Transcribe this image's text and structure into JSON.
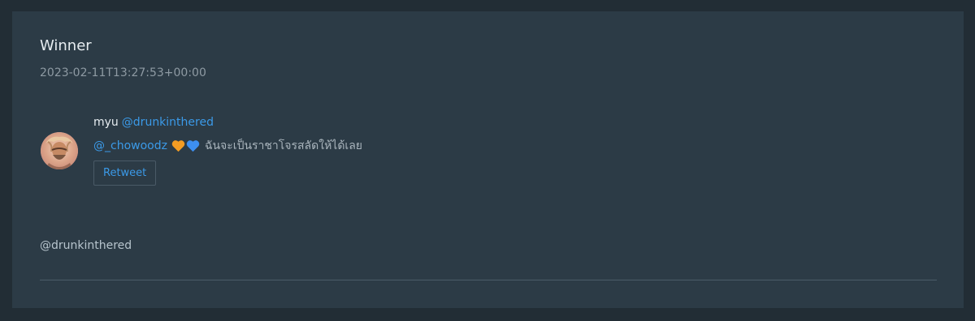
{
  "card": {
    "title": "Winner",
    "timestamp": "2023-02-11T13:27:53+00:00"
  },
  "tweet": {
    "author_name": "myu",
    "author_handle": "@drunkinthered",
    "mention": "@_chowoodz",
    "emojis": [
      "orange-heart-icon",
      "blue-heart-icon"
    ],
    "text": "ฉันจะเป็นราชาโจรสลัดให้ได้เลย",
    "retweet_label": "Retweet",
    "avatar_icon": "user-avatar"
  },
  "footer": {
    "handle": "@drunkinthered"
  },
  "colors": {
    "background": "#222d35",
    "card": "#2c3b46",
    "link": "#3b9ae8",
    "orange_heart": "#f39c23",
    "blue_heart": "#3d8ff0"
  }
}
